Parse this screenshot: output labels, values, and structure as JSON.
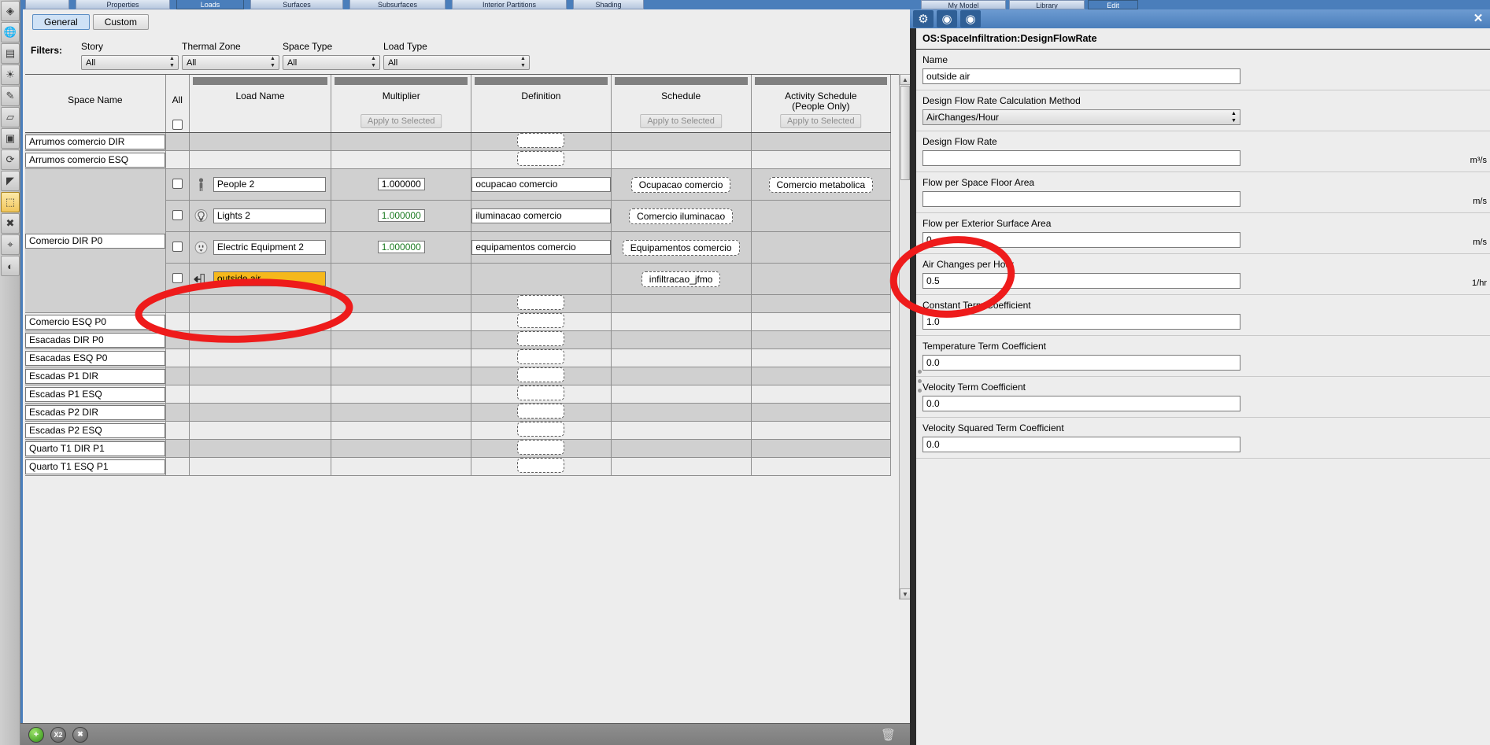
{
  "app": {
    "left_rail_tools": [
      {
        "name": "select-tool",
        "glyph": "◈"
      },
      {
        "name": "globe-tool",
        "glyph": "🌐"
      },
      {
        "name": "eraser-tool",
        "glyph": "▤"
      },
      {
        "name": "shadow-tool",
        "glyph": "☀"
      },
      {
        "name": "paint-tool",
        "glyph": "✎"
      },
      {
        "name": "measure-tool",
        "glyph": "▱"
      },
      {
        "name": "openstudio-tool",
        "glyph": "▣"
      },
      {
        "name": "rotate-tool",
        "glyph": "⟳"
      },
      {
        "name": "surface-tool",
        "glyph": "◤"
      },
      {
        "name": "space-tool",
        "glyph": "⬚"
      },
      {
        "name": "loads-tool",
        "glyph": "✖"
      },
      {
        "name": "info-tool",
        "glyph": "⌖"
      },
      {
        "name": "render-tool",
        "glyph": "◐"
      }
    ]
  },
  "top_tabs": [
    {
      "label": "",
      "name": "tab-scroll-left"
    },
    {
      "label": "Properties",
      "name": "tab-properties"
    },
    {
      "label": "Loads",
      "name": "tab-loads",
      "active": true
    },
    {
      "label": "Surfaces",
      "name": "tab-surfaces"
    },
    {
      "label": "Subsurfaces",
      "name": "tab-subsurfaces"
    },
    {
      "label": "Interior Partitions",
      "name": "tab-interior-partitions"
    },
    {
      "label": "Shading",
      "name": "tab-shading"
    }
  ],
  "subtabs": [
    {
      "label": "General",
      "active": true
    },
    {
      "label": "Custom",
      "active": false
    }
  ],
  "filters": {
    "label": "Filters:",
    "items": [
      {
        "label": "Story",
        "value": "All"
      },
      {
        "label": "Thermal Zone",
        "value": "All"
      },
      {
        "label": "Space Type",
        "value": "All"
      },
      {
        "label": "Load Type",
        "value": "All"
      }
    ]
  },
  "grid": {
    "columns": [
      {
        "label": "Space Name",
        "apply": null
      },
      {
        "label": "All",
        "apply": null
      },
      {
        "label": "Load Name",
        "apply": null
      },
      {
        "label": "Multiplier",
        "apply": "Apply to Selected"
      },
      {
        "label": "Definition",
        "apply": null
      },
      {
        "label": "Schedule",
        "apply": "Apply to Selected"
      },
      {
        "label": "Activity Schedule\n(People Only)",
        "apply": "Apply to Selected"
      }
    ],
    "column_headers": {
      "space_name": "Space Name",
      "all": "All",
      "load_name": "Load Name",
      "multiplier": "Multiplier",
      "definition": "Definition",
      "schedule": "Schedule",
      "activity_schedule_line1": "Activity Schedule",
      "activity_schedule_line2": "(People Only)",
      "apply_to_selected": "Apply to Selected"
    },
    "rows": [
      {
        "space_name": "Arrumos comercio DIR",
        "shaded": true,
        "loads": [],
        "trailing_definition_pill": true
      },
      {
        "space_name": "Arrumos comercio ESQ",
        "shaded": false,
        "loads": [],
        "trailing_definition_pill": true
      },
      {
        "space_name": "Comercio DIR P0",
        "shaded": true,
        "expanded": true,
        "loads": [
          {
            "icon": "person-icon",
            "name": "People 2",
            "multiplier": "1.000000",
            "multiplier_green": false,
            "definition": "ocupacao comercio",
            "schedule": "Ocupacao comercio",
            "activity_schedule": "Comercio metabolica",
            "highlight": false
          },
          {
            "icon": "lightbulb-icon",
            "name": "Lights 2",
            "multiplier": "1.000000",
            "multiplier_green": true,
            "definition": "iluminacao comercio",
            "schedule": "Comercio iluminacao",
            "activity_schedule": null,
            "highlight": false
          },
          {
            "icon": "outlet-icon",
            "name": "Electric Equipment 2",
            "multiplier": "1.000000",
            "multiplier_green": true,
            "definition": "equipamentos comercio",
            "schedule": "Equipamentos comercio",
            "activity_schedule": null,
            "highlight": false
          },
          {
            "icon": "infiltration-arrow-icon",
            "name": "outside air",
            "multiplier": null,
            "multiplier_green": false,
            "definition": null,
            "schedule": "infiltracao_jfmo",
            "activity_schedule": null,
            "highlight": true
          }
        ],
        "trailing_definition_pill": true
      },
      {
        "space_name": "Comercio ESQ P0",
        "shaded": false,
        "loads": [],
        "trailing_definition_pill": true
      },
      {
        "space_name": "Esacadas DIR P0",
        "shaded": true,
        "loads": [],
        "trailing_definition_pill": true
      },
      {
        "space_name": "Esacadas ESQ P0",
        "shaded": false,
        "loads": [],
        "trailing_definition_pill": true
      },
      {
        "space_name": "Escadas P1 DIR",
        "shaded": true,
        "loads": [],
        "trailing_definition_pill": true
      },
      {
        "space_name": "Escadas P1 ESQ",
        "shaded": false,
        "loads": [],
        "trailing_definition_pill": true
      },
      {
        "space_name": "Escadas P2 DIR",
        "shaded": true,
        "loads": [],
        "trailing_definition_pill": true
      },
      {
        "space_name": "Escadas P2 ESQ",
        "shaded": false,
        "loads": [],
        "trailing_definition_pill": true
      },
      {
        "space_name": "Quarto T1 DIR P1",
        "shaded": true,
        "loads": [],
        "trailing_definition_pill": true
      },
      {
        "space_name": "Quarto T1 ESQ P1",
        "shaded": false,
        "loads": [],
        "trailing_definition_pill": true
      }
    ]
  },
  "bottom_toolbar": {
    "add_label": "+",
    "duplicate_label": "X2",
    "remove_label": "✖",
    "purge_icon": "trash-icon"
  },
  "inspector": {
    "tabs": [
      {
        "label": "My Model",
        "active": false
      },
      {
        "label": "Library",
        "active": false
      },
      {
        "label": "Edit",
        "active": true
      }
    ],
    "toolbar_icons": [
      {
        "name": "gear-icon",
        "glyph": "⚙",
        "on": true
      },
      {
        "name": "bulb-icon-1",
        "glyph": "◉",
        "on": true
      },
      {
        "name": "bulb-icon-2",
        "glyph": "◉",
        "on": true
      }
    ],
    "close_label": "✕",
    "title": "OS:SpaceInfiltration:DesignFlowRate",
    "fields": [
      {
        "label": "Name",
        "value": "outside air",
        "type": "text",
        "unit": ""
      },
      {
        "label": "Design Flow Rate Calculation Method",
        "value": "AirChanges/Hour",
        "type": "combo",
        "unit": ""
      },
      {
        "label": "Design Flow Rate",
        "value": "",
        "type": "text",
        "unit": "m³/s"
      },
      {
        "label": "Flow per Space Floor Area",
        "value": "",
        "type": "text",
        "unit": "m/s"
      },
      {
        "label": "Flow per Exterior Surface Area",
        "value": "0",
        "type": "text",
        "unit": "m/s"
      },
      {
        "label": "Air Changes per Hour",
        "value": "0.5",
        "type": "text",
        "unit": "1/hr"
      },
      {
        "label": "Constant Term Coefficient",
        "value": "1.0",
        "type": "text",
        "unit": ""
      },
      {
        "label": "Temperature Term Coefficient",
        "value": "0.0",
        "type": "text",
        "unit": ""
      },
      {
        "label": "Velocity Term Coefficient",
        "value": "0.0",
        "type": "text",
        "unit": ""
      },
      {
        "label": "Velocity Squared Term Coefficient",
        "value": "0.0",
        "type": "text",
        "unit": ""
      }
    ]
  },
  "annotations": {
    "color": "#ee1b1b",
    "marks": [
      {
        "name": "ellipse-outside-air-row",
        "shape": "ellipse"
      },
      {
        "name": "ellipse-air-changes-per-hour",
        "shape": "ellipse"
      }
    ]
  }
}
